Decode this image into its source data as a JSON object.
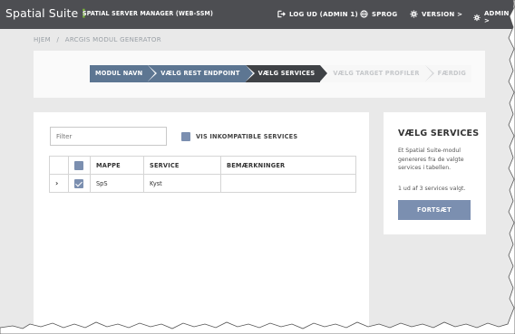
{
  "header": {
    "brand": "Spatial Suite",
    "brand_dots": "⋮",
    "app_name": "SPATIAL SERVER MANAGER (WEB-SSM)",
    "logout": "LOG UD (ADMIN 1)",
    "language": "SPROG",
    "version": "VERSION >",
    "admin": "ADMIN >"
  },
  "breadcrumb": {
    "home": "HJEM",
    "separator": "/",
    "current": "ARCGIS MODUL GENERATOR"
  },
  "wizard": {
    "steps": [
      {
        "label": "MODUL NAVN",
        "state": "done"
      },
      {
        "label": "VÆLG REST ENDPOINT",
        "state": "done"
      },
      {
        "label": "VÆLG SERVICES",
        "state": "active"
      },
      {
        "label": "VÆLG TARGET PROFILER",
        "state": "todo"
      },
      {
        "label": "FÆRDIG",
        "state": "todo"
      }
    ]
  },
  "main": {
    "filter_placeholder": "Filter",
    "show_incompatible_label": "VIS INKOMPATIBLE SERVICES",
    "table": {
      "columns": [
        "",
        "",
        "MAPPE",
        "SERVICE",
        "BEMÆRKNINGER"
      ],
      "rows": [
        {
          "expander": "›",
          "checked": true,
          "mappe": "SpS",
          "service": "Kyst",
          "remarks": ""
        }
      ]
    }
  },
  "side": {
    "title": "VÆLG SERVICES",
    "description": "Et Spatial Suite-modul genereres fra de valgte services i tabellen.",
    "selection_count": "1 ud af 3 services valgt.",
    "continue_button": "FORTSÆT"
  },
  "colors": {
    "topbar": "#4d4e52",
    "accent_blue": "#7b8fb0",
    "step_done": "#5d7692",
    "step_active": "#3f4246",
    "brand_dots": "#7fbf3a",
    "background": "#e9e9e9"
  },
  "icons": {
    "logout": "sign-out-icon",
    "language": "globe-icon",
    "version": "gear-icon",
    "admin": "gear-icon"
  }
}
